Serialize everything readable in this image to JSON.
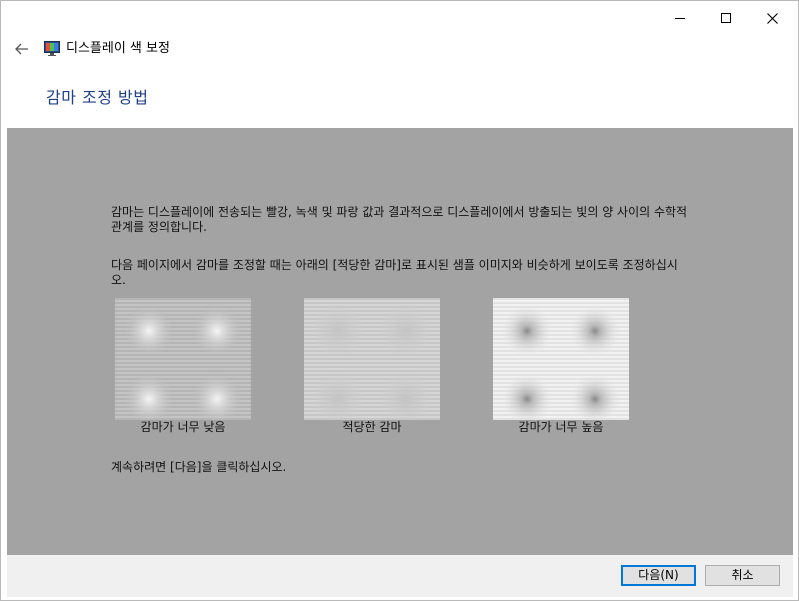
{
  "window": {
    "title": "디스플레이 색 보정",
    "controls": {
      "minimize_icon": "minimize-icon",
      "maximize_icon": "maximize-icon",
      "close_icon": "close-icon"
    }
  },
  "nav": {
    "back_icon": "back-arrow-icon",
    "app_icon": "display-color-calibration-icon"
  },
  "page": {
    "heading": "감마 조정 방법",
    "paragraph1": "감마는 디스플레이에 전송되는 빨강, 녹색 및 파랑 값과 결과적으로 디스플레이에서 방출되는 빛의 양 사이의 수학적 관계를 정의합니다.",
    "paragraph2": "다음 페이지에서 감마를 조정할 때는 아래의 [적당한 감마]로 표시된 샘플 이미지와 비슷하게 보이도록 조정하십시오.",
    "samples": [
      {
        "label": "감마가 너무 낮음",
        "kind": "low"
      },
      {
        "label": "적당한 감마",
        "kind": "ok"
      },
      {
        "label": "감마가 너무 높음",
        "kind": "high"
      }
    ],
    "paragraph3": "계속하려면 [다음]을 클릭하십시오."
  },
  "footer": {
    "next_label": "다음(N)",
    "cancel_label": "취소"
  },
  "colors": {
    "content_bg": "#a3a3a3",
    "heading": "#1e3f8a",
    "footer_bg": "#f0f0f0",
    "default_button_border": "#0078d7"
  }
}
